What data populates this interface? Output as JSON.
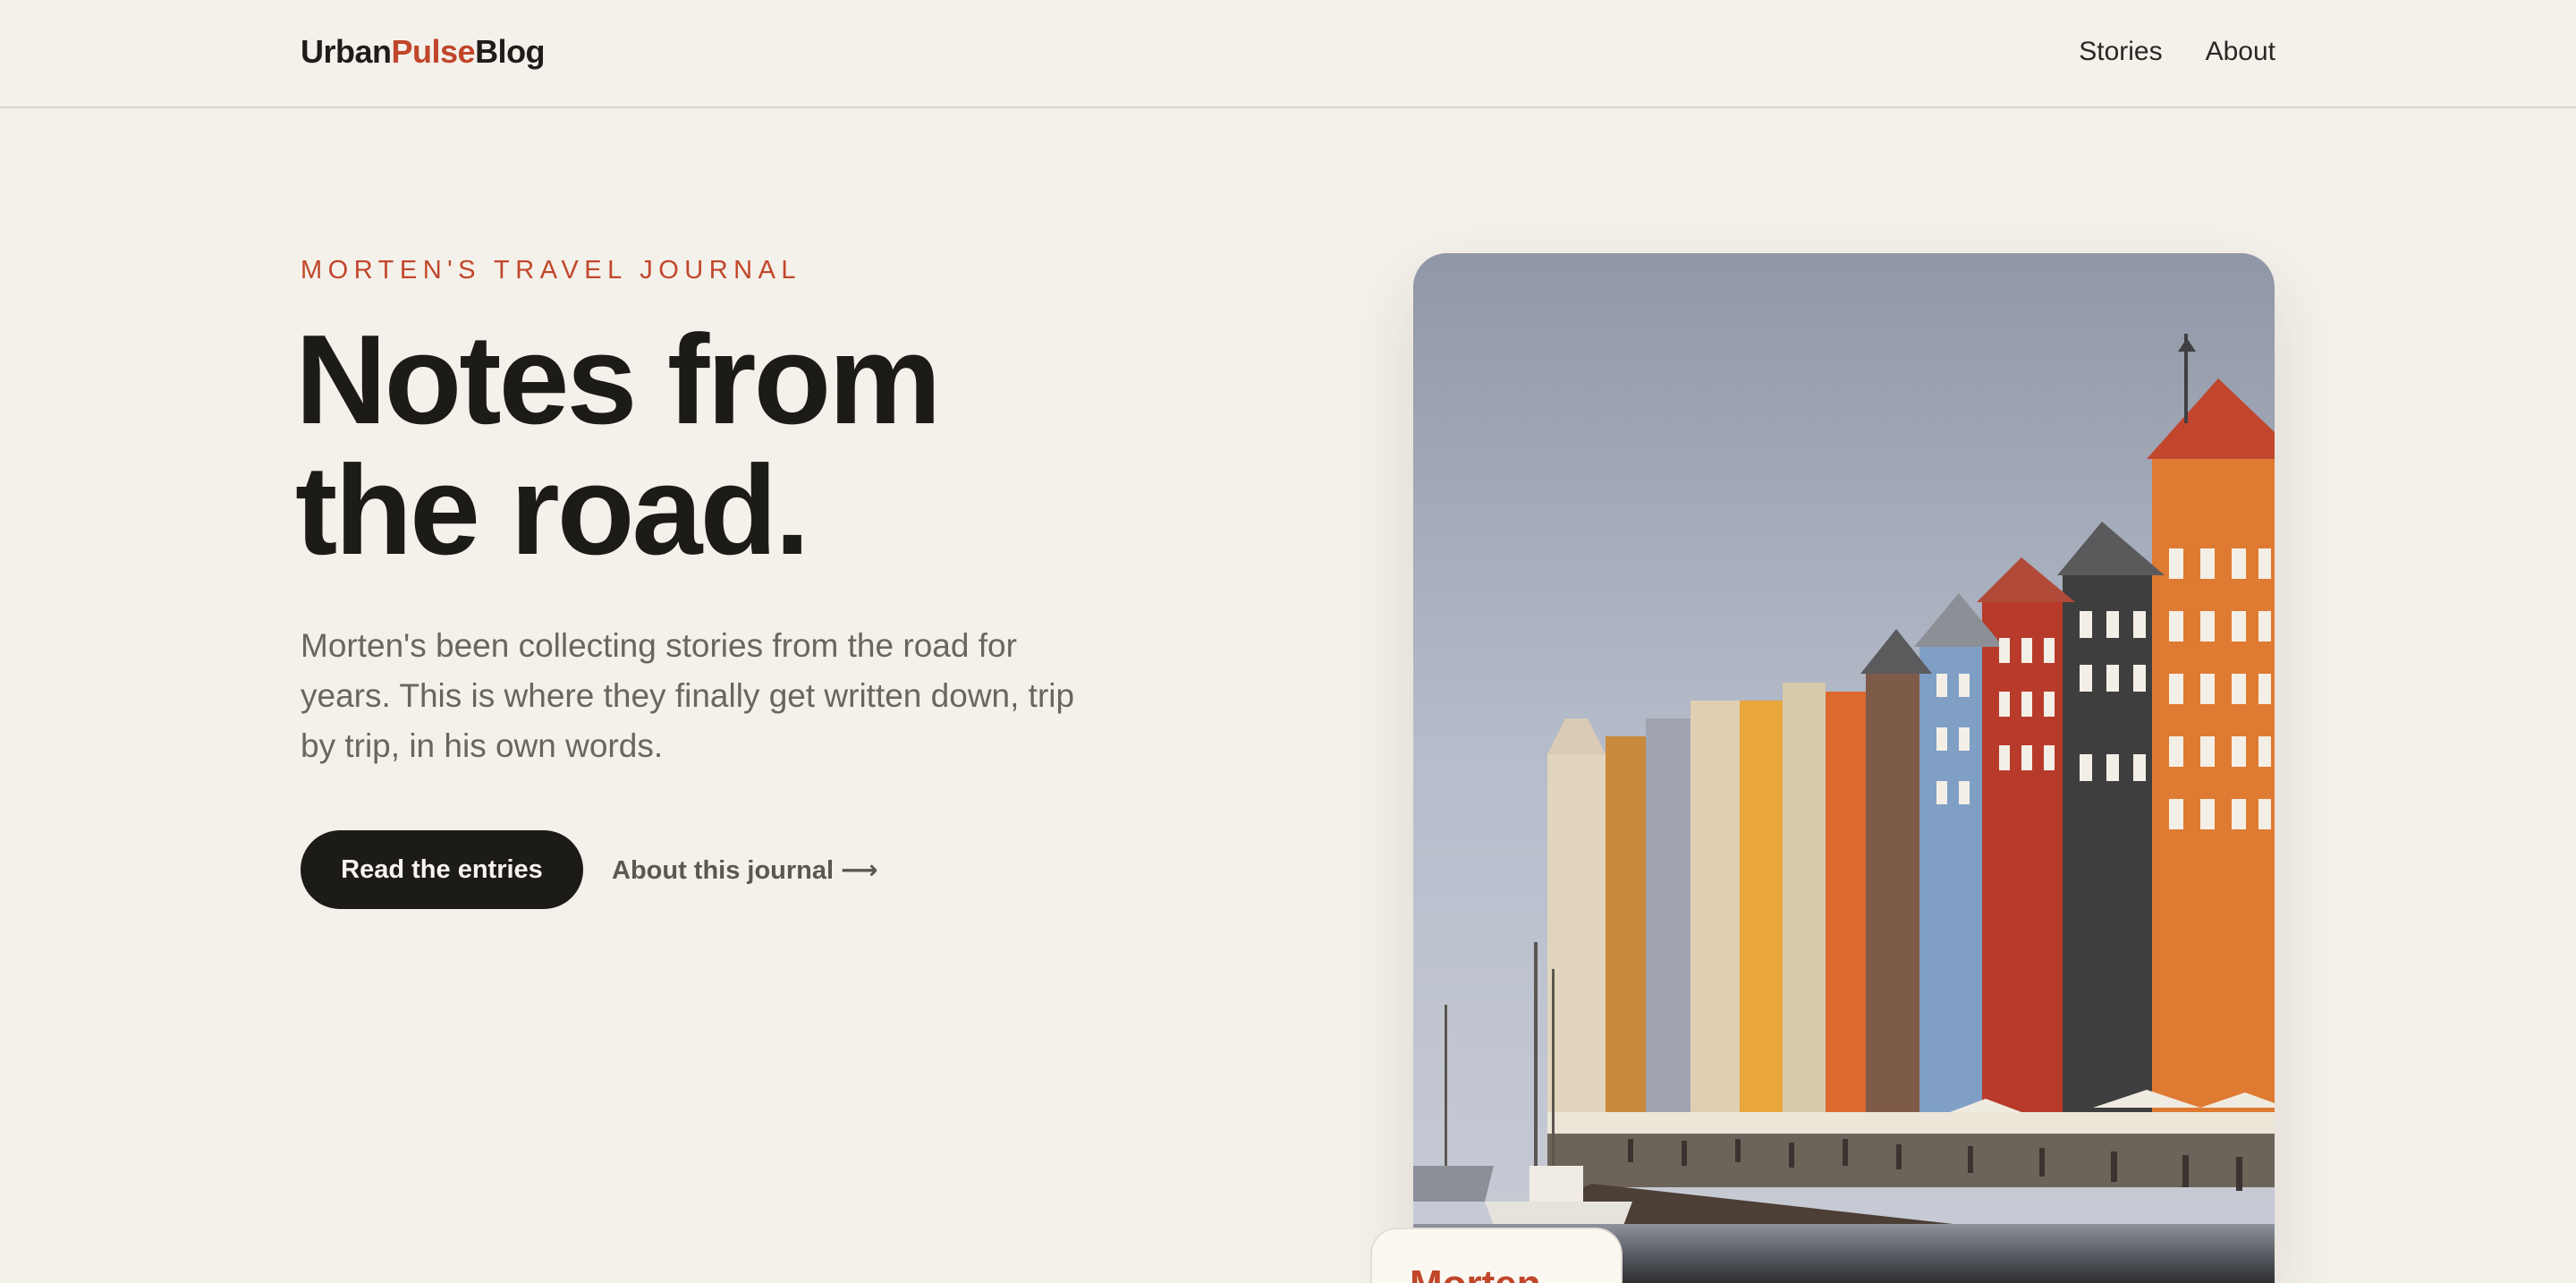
{
  "brand": {
    "part1": "Urban",
    "part2": "Pulse",
    "part3": "Blog",
    "accent_color": "#c1462a"
  },
  "nav": {
    "items": [
      {
        "label": "Stories"
      },
      {
        "label": "About"
      }
    ]
  },
  "hero": {
    "eyebrow": "MORTEN'S TRAVEL JOURNAL",
    "headline_line1": "Notes from",
    "headline_line2": "the road.",
    "lead": "Morten's been collecting stories from the road for years. This is where they finally get written down, trip by trip, in his own words.",
    "primary_cta": "Read the entries",
    "secondary_cta": "About this journal ⟶"
  },
  "photo": {
    "caption_tab": "Morten"
  },
  "colors": {
    "background": "#f4f0ea",
    "text": "#1d1b18",
    "muted": "#6a655e",
    "button": "#1d1b18"
  }
}
